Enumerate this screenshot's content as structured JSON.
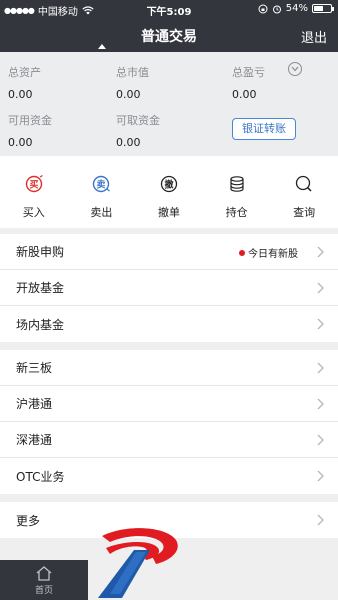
{
  "status_bar": {
    "carrier": "中国移动",
    "time": "下午5:09",
    "battery": "54%",
    "battery_level": 0.54
  },
  "nav": {
    "title": "普通交易",
    "logout": "退出"
  },
  "summary": {
    "total_assets_label": "总资产",
    "total_assets_value": "0.00",
    "market_value_label": "总市值",
    "market_value_value": "0.00",
    "total_pl_label": "总盈亏",
    "total_pl_value": "0.00",
    "available_funds_label": "可用资金",
    "available_funds_value": "0.00",
    "withdrawable_label": "可取资金",
    "withdrawable_value": "0.00",
    "transfer_button": "银证转账"
  },
  "actions": [
    {
      "label": "买入",
      "icon": "buy-icon"
    },
    {
      "label": "卖出",
      "icon": "sell-icon"
    },
    {
      "label": "撤单",
      "icon": "cancel-order-icon"
    },
    {
      "label": "持仓",
      "icon": "holdings-icon"
    },
    {
      "label": "查询",
      "icon": "search-icon"
    }
  ],
  "menu_group_1": [
    {
      "label": "新股申购",
      "badge": "今日有新股"
    },
    {
      "label": "开放基金"
    },
    {
      "label": "场内基金"
    }
  ],
  "menu_group_2": [
    {
      "label": "新三板"
    },
    {
      "label": "沪港通"
    },
    {
      "label": "深港通"
    },
    {
      "label": "OTC业务"
    }
  ],
  "menu_group_3": [
    {
      "label": "更多"
    }
  ],
  "tabbar": {
    "home_label": "首页"
  },
  "colors": {
    "header_bg": "#33363d",
    "accent_blue": "#3a76c8",
    "badge_red": "#e11b22",
    "buy_red": "#d9302c",
    "sell_blue": "#3a76c8"
  }
}
